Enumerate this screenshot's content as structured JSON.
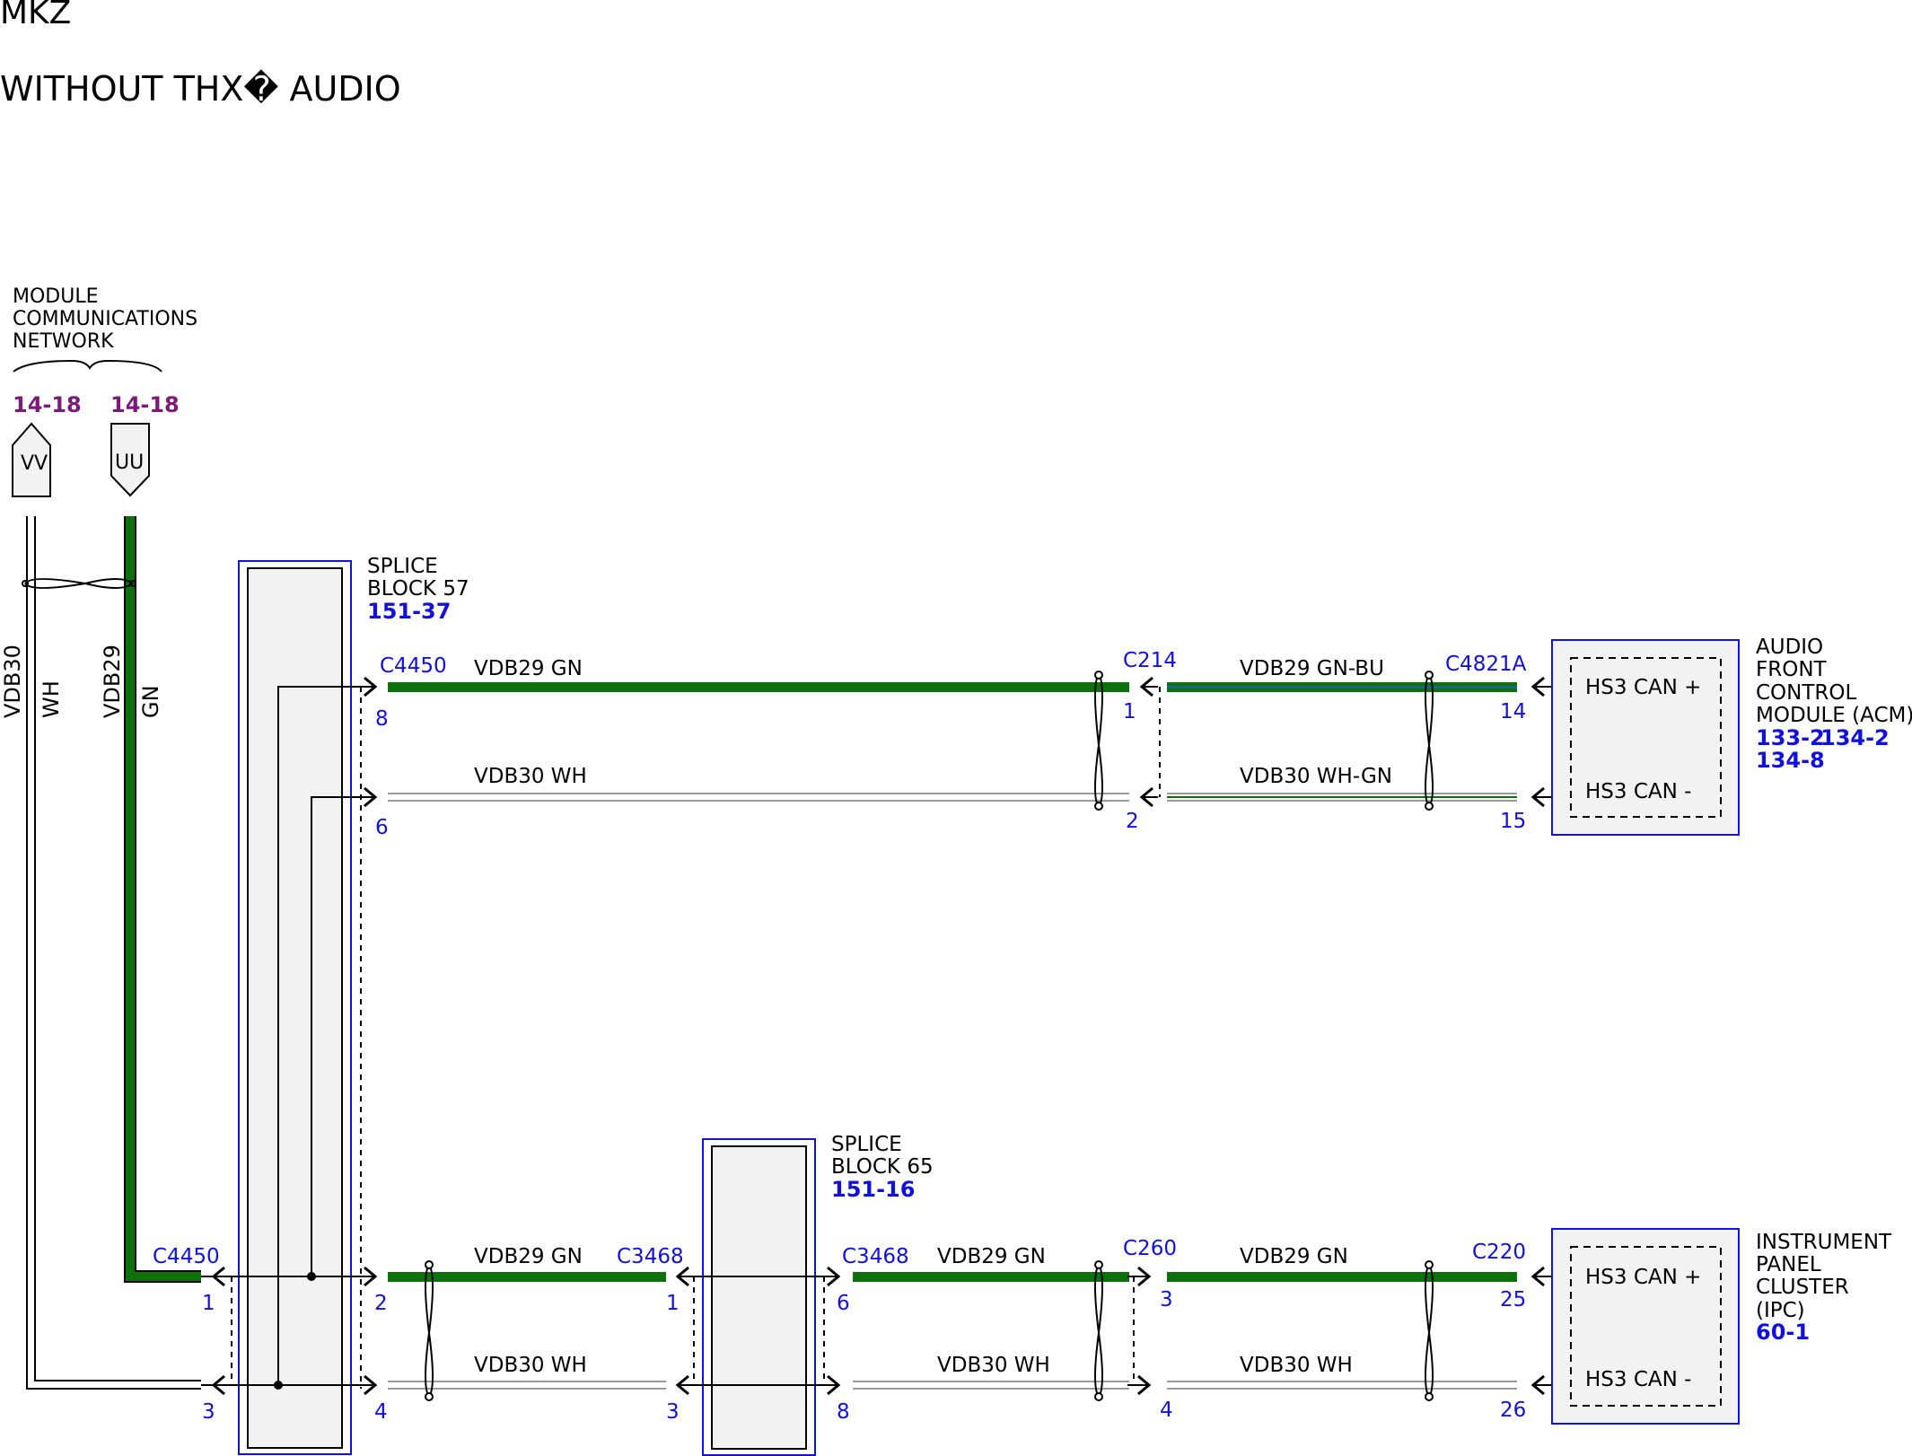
{
  "header": {
    "line1": "MKZ",
    "line2": "WITHOUT THX� AUDIO"
  },
  "network": {
    "label_line1": "MODULE",
    "label_line2": "COMMUNICATIONS",
    "label_line3": "NETWORK",
    "ref_vv": "14-18",
    "ref_uu": "14-18",
    "connector_vv": "VV",
    "connector_uu": "UU"
  },
  "vertical_wires": {
    "vdb30": "VDB30",
    "wh": "WH",
    "vdb29": "VDB29",
    "gn": "GN"
  },
  "splice57": {
    "line1": "SPLICE",
    "line2": "BLOCK 57",
    "ref": "151-37"
  },
  "splice65": {
    "line1": "SPLICE",
    "line2": "BLOCK 65",
    "ref": "151-16"
  },
  "acm": {
    "line1": "AUDIO",
    "line2": "FRONT",
    "line3": "CONTROL",
    "line4": "MODULE (ACM)",
    "ref1": "133-2",
    "ref2": "134-2",
    "ref3": "134-8",
    "pin_plus": "HS3 CAN +",
    "pin_minus": "HS3 CAN -"
  },
  "ipc": {
    "line1": "INSTRUMENT",
    "line2": "PANEL",
    "line3": "CLUSTER",
    "line4": "(IPC)",
    "ref": "60-1",
    "pin_plus": "HS3 CAN +",
    "pin_minus": "HS3 CAN -"
  },
  "connectors": {
    "c4450": "C4450",
    "c214": "C214",
    "c4821a": "C4821A",
    "c3468": "C3468",
    "c260": "C260",
    "c220": "C220"
  },
  "pins": {
    "top_c4450_a": "8",
    "top_c4450_b": "6",
    "c214_a": "1",
    "c214_b": "2",
    "c4821a_a": "14",
    "c4821a_b": "15",
    "left_c4450_a": "1",
    "left_c4450_b": "3",
    "bottom_c4450_a": "2",
    "bottom_c4450_b": "4",
    "c3468_left_a": "1",
    "c3468_left_b": "3",
    "c3468_right_a": "6",
    "c3468_right_b": "8",
    "c260_a": "3",
    "c260_b": "4",
    "c220_a": "25",
    "c220_b": "26"
  },
  "wires": {
    "top_gn": "VDB29  GN",
    "top_wh": "VDB30  WH",
    "acm_gnbu": "VDB29  GN-BU",
    "acm_whgn": "VDB30  WH-GN",
    "bot1_gn": "VDB29  GN",
    "bot1_wh": "VDB30  WH",
    "bot2_gn": "VDB29  GN",
    "bot2_wh": "VDB30  WH",
    "bot3_gn": "VDB29  GN",
    "bot3_wh": "VDB30  WH"
  },
  "colors": {
    "green_wire": "#0c700c",
    "white_wire": "#9a9a9a",
    "blue_connector": "#1010e0",
    "purple_ref": "#7b1a7b",
    "module_fill": "#f2f2f2"
  }
}
